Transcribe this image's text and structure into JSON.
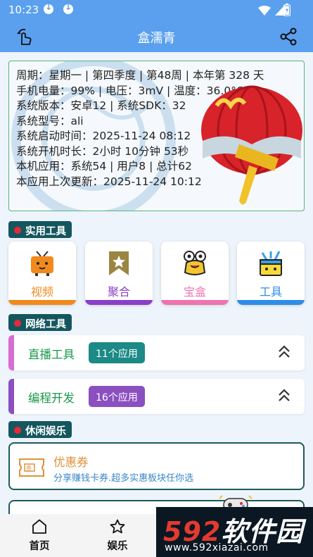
{
  "status_bar": {
    "time": "10:23",
    "icons": [
      "download-icon",
      "download-icon",
      "wifi-icon",
      "signal-icon",
      "battery-icon"
    ]
  },
  "app_bar": {
    "title": "盒濡青",
    "left_icon": "tap-gesture-icon",
    "right_icon": "share-icon"
  },
  "info": {
    "lines": [
      "周期：星期一 | 第四季度 | 第48周 | 本年第 328 天",
      "手机电量：99% | 电压：3mV | 温度：36.0°C",
      "系统版本：安卓12 | 系统SDK：32",
      "系统型号：ali",
      "系统启动时间：2025-11-24 08:12",
      "系统开机时长：2小时 10分钟 53秒",
      "本机应用：系统54 | 用户8 | 总计62",
      "本应用上次更新：2025-11-24 10:12"
    ]
  },
  "sections": {
    "tools": "实用工具",
    "network": "网络工具",
    "leisure": "休闲娱乐"
  },
  "tools": [
    {
      "label": "视频",
      "icon": "tv-icon",
      "color": "#f08a1c"
    },
    {
      "label": "聚合",
      "icon": "bookmark-star-icon",
      "color": "#8b3fc8"
    },
    {
      "label": "宝盒",
      "icon": "mascot-icon",
      "color": "#ee74b0"
    },
    {
      "label": "工具",
      "icon": "toolbox-icon",
      "color": "#2f8de8"
    }
  ],
  "network_items": [
    {
      "name": "直播工具",
      "badge": "11个应用",
      "badge_color": "#1c8a86",
      "accent": "#d86cd4"
    },
    {
      "name": "编程开发",
      "badge": "16个应用",
      "badge_color": "#8b4fc0",
      "accent": "#8b4fc0"
    }
  ],
  "coupon": {
    "title": "优惠券",
    "subtitle": "分享赚钱卡券.超多实惠板块任你选",
    "icon": "coupon-ticket-icon"
  },
  "tabbar": [
    {
      "label": "首页",
      "icon": "home-icon"
    },
    {
      "label": "娱乐",
      "icon": "star-icon"
    }
  ],
  "watermark": {
    "brand_num": "592",
    "brand_text": "软件园",
    "url": "www.592xiazai.com"
  },
  "colors": {
    "primary": "#5aa0ee",
    "section": "#14565e",
    "section_dot": "#e5293b",
    "card_border": "#57b57d"
  }
}
